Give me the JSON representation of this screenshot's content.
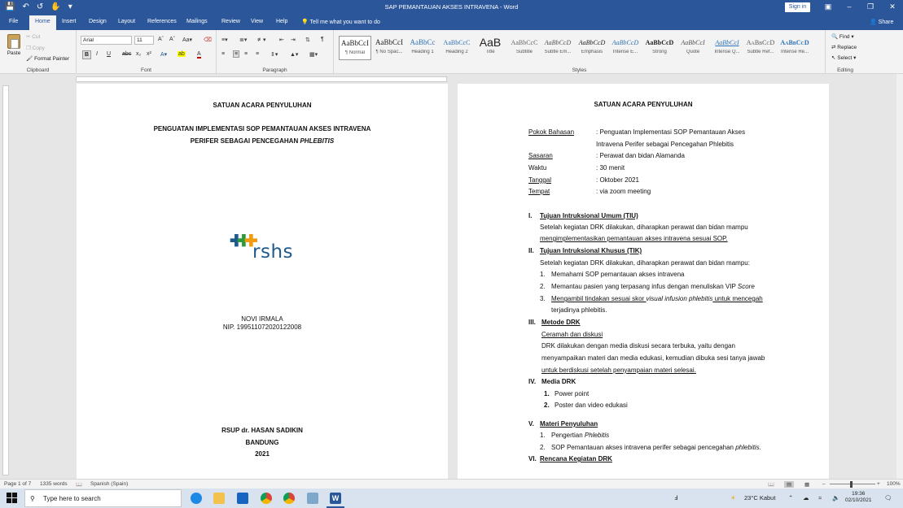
{
  "window": {
    "title": "SAP PEMANTAUAN AKSES INTRAVENA - Word",
    "signin_label": "Sign in"
  },
  "tabs": [
    "File",
    "Home",
    "Insert",
    "Design",
    "Layout",
    "References",
    "Mailings",
    "Review",
    "View",
    "Help"
  ],
  "tellme": "Tell me what you want to do",
  "share_label": "Share",
  "ribbon": {
    "clipboard": {
      "label": "Clipboard",
      "paste": "Paste",
      "cut": "Cut",
      "copy": "Copy",
      "format_painter": "Format Painter"
    },
    "font": {
      "label": "Font",
      "font_name": "Arial",
      "font_size": "11"
    },
    "paragraph": {
      "label": "Paragraph"
    },
    "styles": {
      "label": "Styles",
      "items": [
        {
          "sample": "AaBbCcI",
          "name": "¶ Normal"
        },
        {
          "sample": "AaBbCcI",
          "name": "¶ No Spac..."
        },
        {
          "sample": "AaBbCc",
          "name": "Heading 1"
        },
        {
          "sample": "AaBbCcC",
          "name": "Heading 2"
        },
        {
          "sample": "AaB",
          "name": "Title"
        },
        {
          "sample": "AaBbCcC",
          "name": "Subtitle"
        },
        {
          "sample": "AaBbCcD",
          "name": "Subtle Em..."
        },
        {
          "sample": "AaBbCcD",
          "name": "Emphasis"
        },
        {
          "sample": "AaBbCcD",
          "name": "Intense E..."
        },
        {
          "sample": "AaBbCcD",
          "name": "Strong"
        },
        {
          "sample": "AaBbCcI",
          "name": "Quote"
        },
        {
          "sample": "AaBbCcI",
          "name": "Intense Q..."
        },
        {
          "sample": "AaBbCcD",
          "name": "Subtle Ref..."
        },
        {
          "sample": "AaBbCcD",
          "name": "Intense Re..."
        }
      ]
    },
    "editing": {
      "label": "Editing",
      "find": "Find",
      "replace": "Replace",
      "select": "Select"
    }
  },
  "page1": {
    "header": "SATUAN ACARA PENYULUHAN",
    "title_line1": "PENGUATAN IMPLEMENTASI SOP PEMANTAUAN AKSES INTRAVENA",
    "title_line2_a": "PERIFER SEBAGAI PENCEGAHAN ",
    "title_line2_b": "PHLEBITIS",
    "logo_text": "rshs",
    "author": "NOVI IRMALA",
    "nip": "NIP. 199511072020122008",
    "institution": "RSUP dr. HASAN SADIKIN",
    "city": "BANDUNG",
    "year": "2021"
  },
  "page2": {
    "header": "SATUAN ACARA PENYULUHAN",
    "info": [
      {
        "label": "Pokok Bahasan",
        "value": ":   Penguatan  Implementasi  SOP  Pemantauan  Akses",
        "cont": "Intravena Perifer sebagai Pencegahan Phlebitis"
      },
      {
        "label": "Sasaran",
        "value": ": Perawat dan bidan Alamanda"
      },
      {
        "label": "Waktu",
        "value": ": 30 menit"
      },
      {
        "label": "Tanggal",
        "value": ": Oktober 2021"
      },
      {
        "label": "Tempat",
        "value": ": via zoom meeting"
      }
    ],
    "s1_num": "I.",
    "s1_title": "Tujuan Intruksional Umum (TIU)",
    "s1_body1": "Setelah  kegiatan  DRK  dilakukan,  diharapkan  perawat  dan  bidan  mampu",
    "s1_body2": "mengimplementasikan pemantauan akses intravena sesuai SOP.",
    "s2_num": "II.",
    "s2_title": "Tujuan Intruksional Khusus (TIK)",
    "s2_body": "Setelah kegiatan DRK dilakukan, diharapkan perawat dan bidan mampu:",
    "s2_item1": "Memahami SOP pemantauan akses intravena",
    "s2_item2_a": "Memantau pasien yang terpasang infus dengan menuliskan VIP ",
    "s2_item2_b": "Score",
    "s2_item3_a": "Mengambil  tindakan  sesuai  skor  ",
    "s2_item3_b": "visual infusion phlebitis",
    "s2_item3_c": "  untuk  mencegah",
    "s2_item3_d": "terjadinya phlebitis.",
    "s3_num": "III.",
    "s3_title": "Metode DRK",
    "s3_line1": "Ceramah dan diskusi",
    "s3_line2": "DRK  dilakukan  dengan  media  diskusi  secara  terbuka,  yaitu  dengan",
    "s3_line3": "menyampaikan materi dan media edukasi, kemudian dibuka sesi tanya jawab",
    "s3_line4": "untuk berdiskusi setelah penyampaian materi selesai.",
    "s4_num": "IV.",
    "s4_title": "Media DRK",
    "s4_item1": "Power point",
    "s4_item2": "Poster dan video edukasi",
    "s5_num": "V.",
    "s5_title": "Materi Penyuluhan",
    "s5_item1_a": "Pengertian ",
    "s5_item1_b": "Phlebitis",
    "s5_item2_a": "SOP Pemantauan akses intravena perifer sebagai pencegahan ",
    "s5_item2_b": "phlebitis.",
    "s6_num": "VI.",
    "s6_title": "Rencana Kegiatan DRK"
  },
  "statusbar": {
    "page": "Page 1 of 7",
    "words": "1335 words",
    "language": "Spanish (Spain)",
    "zoom": "100%"
  },
  "taskbar": {
    "search_placeholder": "Type here to search",
    "weather": "23°C  Kabut",
    "time": "19:36",
    "date": "02/10/2021"
  },
  "colors": {
    "word_blue": "#2b579a",
    "ribbon_bg": "#f3f3f3",
    "taskbar_bg": "#d9e3ef"
  }
}
